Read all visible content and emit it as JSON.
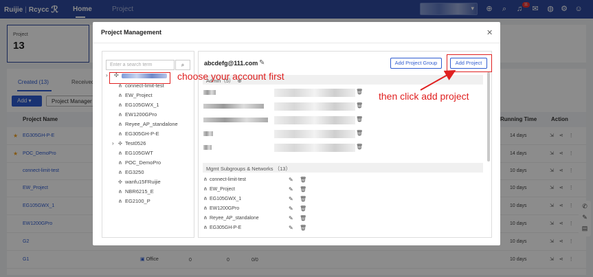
{
  "topbar": {
    "logo_brand": "Ruijie",
    "logo_product": "Rcycc",
    "tabs": [
      "Home",
      "Project"
    ],
    "notification_count": "11"
  },
  "background": {
    "card_label": "Project",
    "card_value": "13",
    "tabs": [
      "Created (13)",
      "Received"
    ],
    "add_button": "Add",
    "pm_button": "Project Manager",
    "columns": [
      "Project Name",
      "Running Time",
      "Action"
    ],
    "rows": [
      {
        "name": "EG305GH-P-E",
        "starred": true,
        "days": "14 days"
      },
      {
        "name": "POC_DemoPro",
        "starred": true,
        "days": "14 days"
      },
      {
        "name": "connect-limit-test",
        "starred": false,
        "days": "10 days"
      },
      {
        "name": "EW_Project",
        "starred": false,
        "days": "10 days"
      },
      {
        "name": "EG105GWX_1",
        "starred": false,
        "days": "10 days"
      },
      {
        "name": "EW1200GPro",
        "starred": false,
        "days": "10 days"
      },
      {
        "name": "G2",
        "starred": false,
        "days": "10 days"
      },
      {
        "name": "G1",
        "starred": false,
        "days": "10 days"
      }
    ],
    "g1_type": "Office",
    "g1_col_a": "0",
    "g1_col_b": "0",
    "g1_col_c": "0/0"
  },
  "modal": {
    "title": "Project Management",
    "search_placeholder": "Enter a search term",
    "tree_items": [
      {
        "label": "connect-limit-test",
        "icon": "network-icon"
      },
      {
        "label": "EW_Project",
        "icon": "network-icon"
      },
      {
        "label": "EG105GWX_1",
        "icon": "network-icon"
      },
      {
        "label": "EW1200GPro",
        "icon": "network-icon"
      },
      {
        "label": "Reyee_AP_standalone",
        "icon": "network-icon"
      },
      {
        "label": "EG305GH-P-E",
        "icon": "network-icon"
      },
      {
        "label": "Test0526",
        "icon": "group-icon",
        "expandable": true
      },
      {
        "label": "EG105GWT",
        "icon": "network-icon"
      },
      {
        "label": "POC_DemoPro",
        "icon": "network-icon"
      },
      {
        "label": "EG3250",
        "icon": "network-icon"
      },
      {
        "label": "wanfu15FRuijie",
        "icon": "group-icon"
      },
      {
        "label": "NBR6215_E",
        "icon": "network-icon"
      },
      {
        "label": "EG2100_P",
        "icon": "network-icon"
      }
    ],
    "account_name": "abcdefg@111.com",
    "add_group_button": "Add Project Group",
    "add_project_button": "Add Project",
    "admin_header": "Admin（5）",
    "mgmt_header": "Mgmt Subgroups & Networks （13）",
    "networks": [
      "connect-limit-test",
      "EW_Project",
      "EG105GWX_1",
      "EW1200GPro",
      "Reyee_AP_standalone",
      "EG305GH-P-E"
    ]
  },
  "annotations": {
    "step1": "choose your account first",
    "step2": "then click add project",
    "color": "#e02020"
  }
}
